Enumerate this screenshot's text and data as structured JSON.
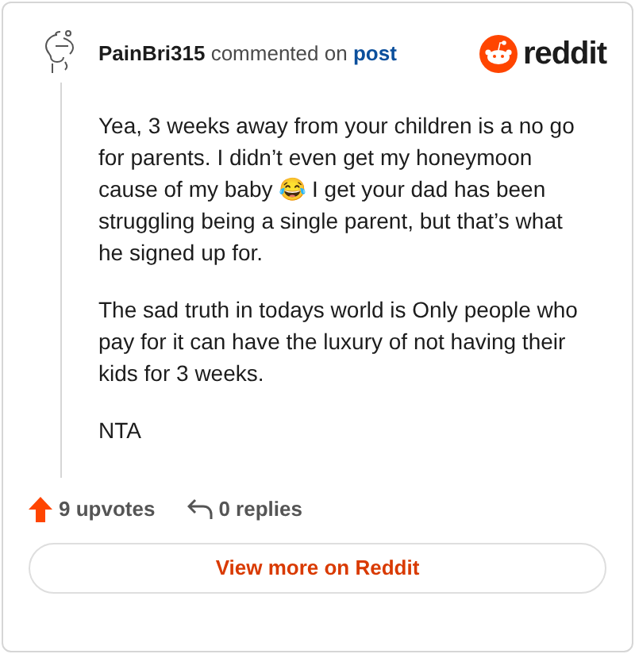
{
  "header": {
    "username": "PainBri315",
    "action": "commented on",
    "link": "post",
    "brand": "reddit"
  },
  "paragraphs": [
    "Yea, 3 weeks away from your children is a no go for parents. I didn’t even get my honeymoon cause of my baby 😂 I get your dad has been struggling being a single parent, but that’s what he signed up for.",
    "The sad truth in todays world is Only people who pay for it can have the luxury of not having their kids for 3 weeks.",
    "NTA"
  ],
  "footer": {
    "upvotes": "9 upvotes",
    "replies": "0 replies"
  },
  "button": "View more on Reddit"
}
